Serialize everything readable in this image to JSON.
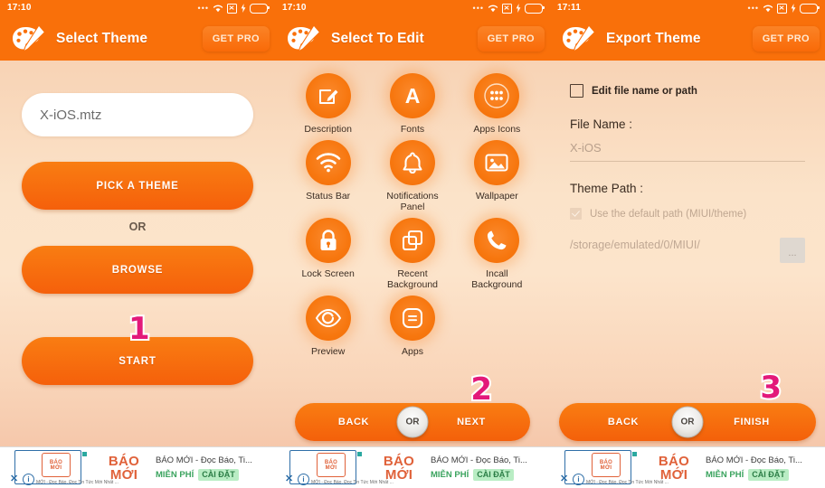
{
  "screens": [
    {
      "status": {
        "time": "17:10",
        "dots": "icon-overflow-dots",
        "wifi": "wifi-icon",
        "sim": "sim-x-icon",
        "charge": "charging-bolt-icon",
        "battery": "battery-icon"
      },
      "appbar": {
        "logo": "palette-icon",
        "title": "Select Theme",
        "get_pro": "GET PRO"
      },
      "file_field": {
        "value": "X-iOS.mtz"
      },
      "pick_button": "PICK A THEME",
      "or_label": "OR",
      "browse_button": "BROWSE",
      "start_button": "START",
      "step_badge": "1"
    },
    {
      "status": {
        "time": "17:10"
      },
      "appbar": {
        "logo": "palette-icon",
        "title": "Select To Edit",
        "get_pro": "GET PRO"
      },
      "grid": [
        {
          "label": "Description",
          "icon": "edit-square-icon"
        },
        {
          "label": "Fonts",
          "icon": "letter-a-icon"
        },
        {
          "label": "Apps Icons",
          "icon": "app-drawer-icon"
        },
        {
          "label": "Status Bar",
          "icon": "wifi-icon"
        },
        {
          "label": "Notifications\nPanel",
          "icon": "bell-icon"
        },
        {
          "label": "Wallpaper",
          "icon": "image-icon"
        },
        {
          "label": "Lock Screen",
          "icon": "lock-icon"
        },
        {
          "label": "Recent\nBackground",
          "icon": "copy-squares-icon"
        },
        {
          "label": "Incall\nBackground",
          "icon": "phone-icon"
        },
        {
          "label": "Preview",
          "icon": "eye-icon"
        },
        {
          "label": "Apps",
          "icon": "list-rounded-icon"
        }
      ],
      "nav": {
        "back": "BACK",
        "or": "OR",
        "next": "NEXT"
      },
      "step_badge": "2"
    },
    {
      "status": {
        "time": "17:11"
      },
      "appbar": {
        "logo": "palette-icon",
        "title": "Export Theme",
        "get_pro": "GET PRO"
      },
      "edit_checkbox_label": "Edit file name or path",
      "file_name_label": "File Name :",
      "file_name_value": "X-iOS",
      "theme_path_label": "Theme Path :",
      "default_path_label": "Use the default path (MIUI/theme)",
      "path_value": "/storage/emulated/0/MIUI/",
      "browse_dots": "...",
      "nav": {
        "back": "BACK",
        "or": "OR",
        "finish": "FINISH"
      },
      "step_badge": "3"
    }
  ],
  "ad": {
    "thumb_line1": "BÁO",
    "thumb_line2": "MỚI",
    "micro_text": "MỚI - Đọc Báo, Đọc Tin Tức Mới Nhất ...",
    "logo_line1": "BÁO",
    "logo_line2": "MỚI",
    "title": "BÁO MỚI - Đọc Báo, Ti...",
    "free_label": "MIỄN PHÍ",
    "cta_label": "CÀI ĐẶT",
    "close_label": "✕",
    "info_label": "i"
  },
  "colors": {
    "brand_orange": "#f9700a",
    "button_orange": "#f5600b",
    "badge_pink": "#e3197a",
    "bg_peach": "#fce4cb"
  }
}
